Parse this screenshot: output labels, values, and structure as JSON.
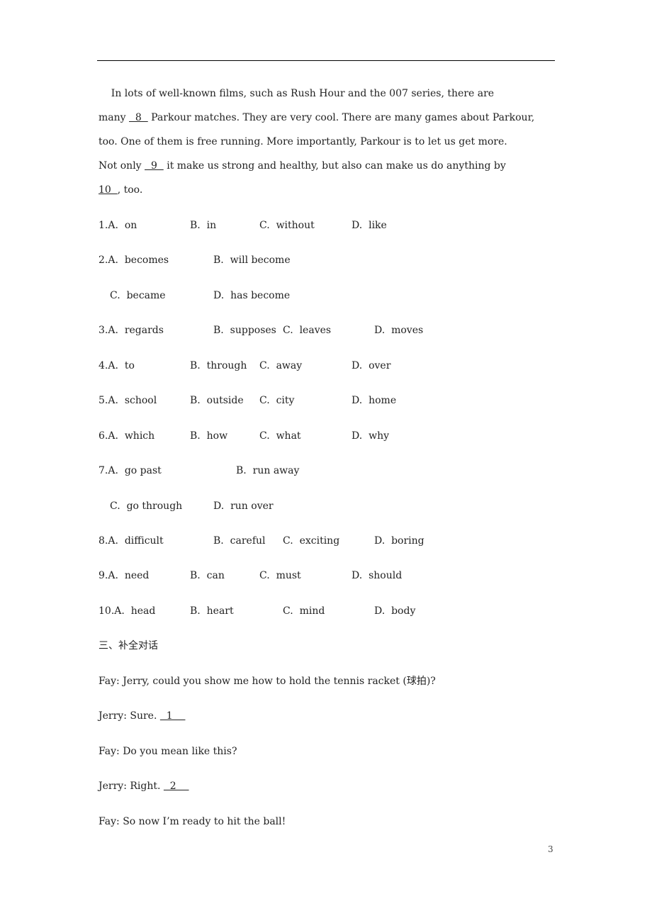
{
  "passage": {
    "lines": [
      {
        "text_before": "    In lots of well-known films, such as Rush Hour and the 007 series, there are"
      },
      {
        "text_before": "many ",
        "blank": "  8  ",
        "text_after": " Parkour matches. They are very cool. There are many games about Parkour,"
      },
      {
        "text_before": "too. One of them is free running. More importantly, Parkour is to let us get more."
      },
      {
        "text_before": "Not only ",
        "blank": "  9  ",
        "text_after": " it make us strong and healthy, but also can make us do anything by"
      },
      {
        "text_before": "",
        "blank": "10  ",
        "text_after": ", too."
      }
    ]
  },
  "questions": [
    {
      "rows": [
        [
          {
            "label": "1.A.",
            "text": "on"
          },
          {
            "label": "B.",
            "text": "in"
          },
          {
            "label": "C.",
            "text": "without"
          },
          {
            "label": "D.",
            "text": "like"
          }
        ]
      ]
    },
    {
      "rows": [
        [
          {
            "label": "2.A.",
            "text": "becomes"
          },
          {
            "label": "B.",
            "text": "will become"
          }
        ],
        [
          {
            "label": "C.",
            "text": "became"
          },
          {
            "label": "D.",
            "text": "has become"
          }
        ]
      ]
    },
    {
      "rows": [
        [
          {
            "label": "3.A.",
            "text": "regards"
          },
          {
            "label": "B.",
            "text": "supposes"
          },
          {
            "label": "C.",
            "text": "leaves"
          },
          {
            "label": "D.",
            "text": "moves"
          }
        ]
      ]
    },
    {
      "rows": [
        [
          {
            "label": "4.A.",
            "text": "to"
          },
          {
            "label": "B.",
            "text": "through"
          },
          {
            "label": "C.",
            "text": "away"
          },
          {
            "label": "D.",
            "text": "over"
          }
        ]
      ]
    },
    {
      "rows": [
        [
          {
            "label": "5.A.",
            "text": "school"
          },
          {
            "label": "B.",
            "text": "outside"
          },
          {
            "label": "C.",
            "text": "city"
          },
          {
            "label": "D.",
            "text": "home"
          }
        ]
      ]
    },
    {
      "rows": [
        [
          {
            "label": "6.A.",
            "text": "which"
          },
          {
            "label": "B.",
            "text": "how"
          },
          {
            "label": "C.",
            "text": "what"
          },
          {
            "label": "D.",
            "text": "why"
          }
        ]
      ]
    },
    {
      "rows": [
        [
          {
            "label": "7.A.",
            "text": "go past"
          },
          {
            "label": "B.",
            "text": "run away"
          }
        ],
        [
          {
            "label": "C.",
            "text": "go through"
          },
          {
            "label": "D.",
            "text": "run over"
          }
        ]
      ]
    },
    {
      "rows": [
        [
          {
            "label": "8.A.",
            "text": "difficult"
          },
          {
            "label": "B.",
            "text": "careful"
          },
          {
            "label": "C.",
            "text": "exciting"
          },
          {
            "label": "D.",
            "text": "boring"
          }
        ]
      ]
    },
    {
      "rows": [
        [
          {
            "label": "9.A.",
            "text": "need"
          },
          {
            "label": "B.",
            "text": "can"
          },
          {
            "label": "C.",
            "text": "must"
          },
          {
            "label": "D.",
            "text": "should"
          }
        ]
      ]
    },
    {
      "rows": [
        [
          {
            "label": "10.A.",
            "text": "head"
          },
          {
            "label": "B.",
            "text": "heart"
          },
          {
            "label": "C.",
            "text": "mind"
          },
          {
            "label": "D.",
            "text": "body"
          }
        ]
      ]
    }
  ],
  "section3": {
    "heading": "三、补全对话",
    "dialogue": [
      {
        "speaker": "Fay:",
        "text": " Jerry, could you show me how to hold the tennis racket (球拍)?"
      },
      {
        "speaker": "Jerry:",
        "text": " Sure. ",
        "blank": "  1    "
      },
      {
        "speaker": "Fay:",
        "text": " Do you mean like this?"
      },
      {
        "speaker": "Jerry:",
        "text": " Right. ",
        "blank": "  2    "
      },
      {
        "speaker": "Fay:",
        "text": " So now I’m ready to hit the ball!"
      }
    ]
  },
  "page_number": "3"
}
